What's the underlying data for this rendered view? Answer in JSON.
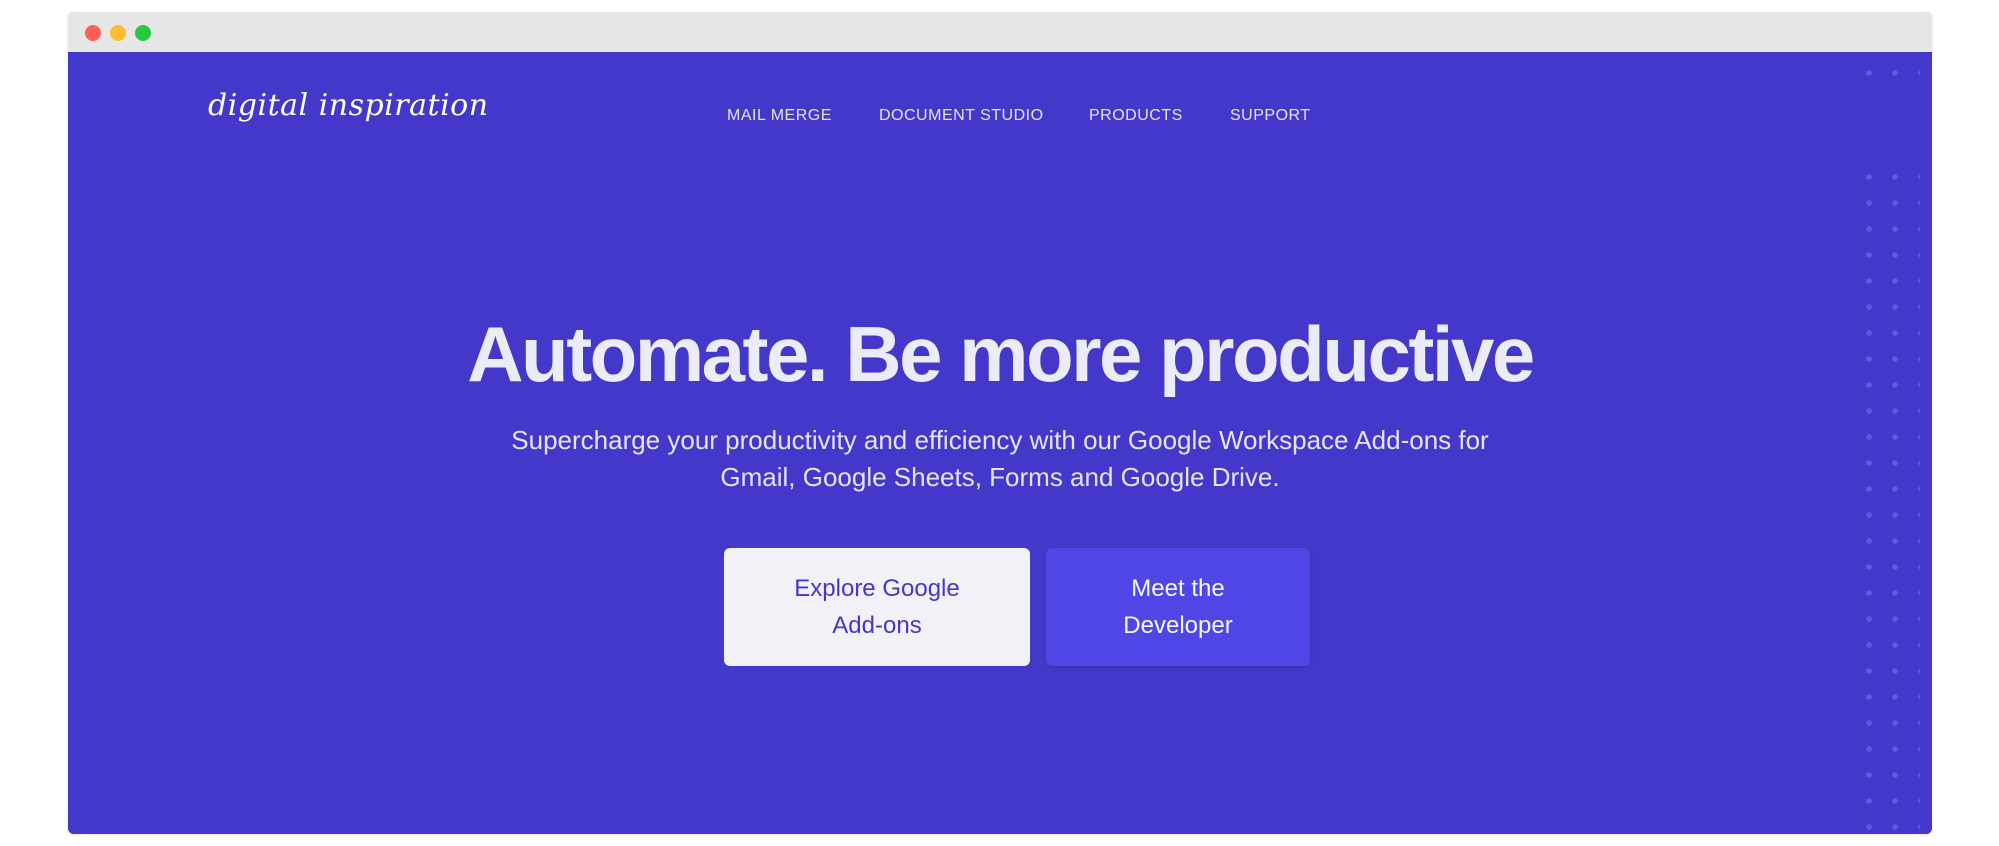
{
  "window": {
    "controls": [
      "close",
      "minimize",
      "maximize"
    ]
  },
  "logo": {
    "text": "digital inspiration"
  },
  "nav": {
    "items": [
      {
        "label": "MAIL MERGE"
      },
      {
        "label": "DOCUMENT STUDIO"
      },
      {
        "label": "PRODUCTS"
      },
      {
        "label": "SUPPORT"
      }
    ]
  },
  "hero": {
    "headline": "Automate. Be more productive",
    "subhead": "Supercharge your productivity and efficiency with our Google Workspace Add-ons for Gmail, Google Sheets, Forms and Google Drive.",
    "primary_cta": "Explore Google Add-ons",
    "secondary_cta": "Meet the Developer"
  },
  "colors": {
    "hero_background": "#4438ca",
    "primary_button_bg": "#f1f1f7",
    "secondary_button_bg": "#4f46e5",
    "titlebar": "#e7e7e7"
  }
}
